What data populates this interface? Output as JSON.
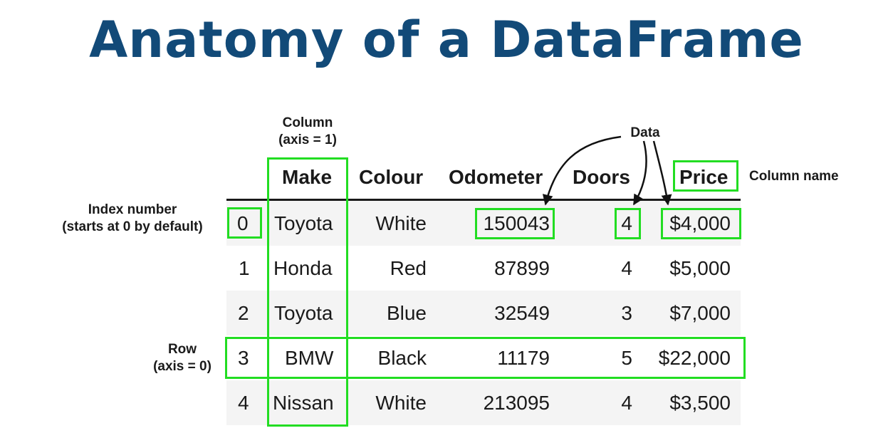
{
  "title": "Anatomy of a DataFrame",
  "annotations": {
    "column_axis": [
      "Column",
      "(axis = 1)"
    ],
    "data": "Data",
    "column_name": "Column name",
    "index_number": [
      "Index number",
      "(starts at 0 by default)"
    ],
    "row_axis": [
      "Row",
      "(axis = 0)"
    ]
  },
  "table": {
    "headers": [
      "Make",
      "Colour",
      "Odometer",
      "Doors",
      "Price"
    ],
    "rows": [
      {
        "index": "0",
        "make": "Toyota",
        "colour": "White",
        "odometer": "150043",
        "doors": "4",
        "price": "$4,000"
      },
      {
        "index": "1",
        "make": "Honda",
        "colour": "Red",
        "odometer": "87899",
        "doors": "4",
        "price": "$5,000"
      },
      {
        "index": "2",
        "make": "Toyota",
        "colour": "Blue",
        "odometer": "32549",
        "doors": "3",
        "price": "$7,000"
      },
      {
        "index": "3",
        "make": "BMW",
        "colour": "Black",
        "odometer": "11179",
        "doors": "5",
        "price": "$22,000"
      },
      {
        "index": "4",
        "make": "Nissan",
        "colour": "White",
        "odometer": "213095",
        "doors": "4",
        "price": "$3,500"
      }
    ]
  },
  "colors": {
    "title": "#124a78",
    "highlight": "#22dd22",
    "stripe": "#f4f4f4",
    "text": "#1a1a1a"
  }
}
